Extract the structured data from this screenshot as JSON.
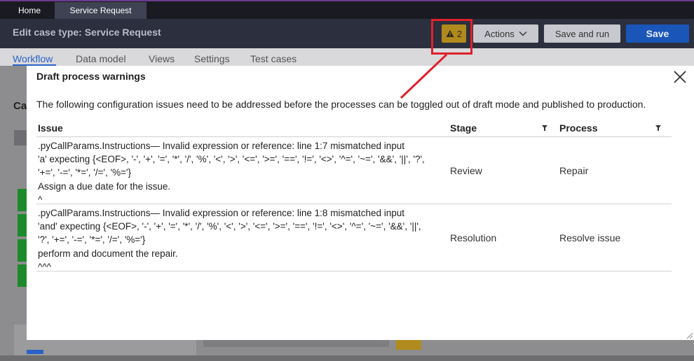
{
  "tabs": [
    {
      "label": "Home"
    },
    {
      "label": "Service Request"
    }
  ],
  "header": {
    "title": "Edit case type: Service Request",
    "warning_count": "2",
    "actions_label": "Actions",
    "save_run_label": "Save and run",
    "save_label": "Save"
  },
  "subnav": [
    "Workflow",
    "Data model",
    "Views",
    "Settings",
    "Test cases"
  ],
  "background": {
    "heading_fragment": "Ca"
  },
  "modal": {
    "title": "Draft process warnings",
    "intro": "The following configuration issues need to be addressed before the processes can be toggled out of draft mode and published to production.",
    "columns": [
      "Issue",
      "Stage",
      "Process"
    ],
    "rows": [
      {
        "issue": ".pyCallParams.Instructions— Invalid expression or reference: line 1:7 mismatched input\n'a' expecting {<EOF>, '-', '+', '=', '*', '/', '%', '<', '>', '<=', '>=', '==', '!=', '<>', '^=', '~=', '&&', '||', '?',\n'+=', '-=', '*=', '/=', '%='}\nAssign a due date for the issue.\n^",
        "stage": "Review",
        "process": "Repair"
      },
      {
        "issue": ".pyCallParams.Instructions— Invalid expression or reference: line 1:8 mismatched input\n'and' expecting {<EOF>, '-', '+', '=', '*', '/', '%', '<', '>', '<=', '>=', '==', '!=', '<>', '^=', '~=', '&&', '||',\n'?', '+=', '-=', '*=', '/=', '%='}\nperform and document the repair.\n^^^",
        "stage": "Resolution",
        "process": "Resolve issue"
      }
    ]
  },
  "colors": {
    "accent_red": "#e0202a",
    "warning_badge": "#b08a1c",
    "primary_blue": "#1a55b8",
    "active_tab_blue": "#2a62c7"
  }
}
